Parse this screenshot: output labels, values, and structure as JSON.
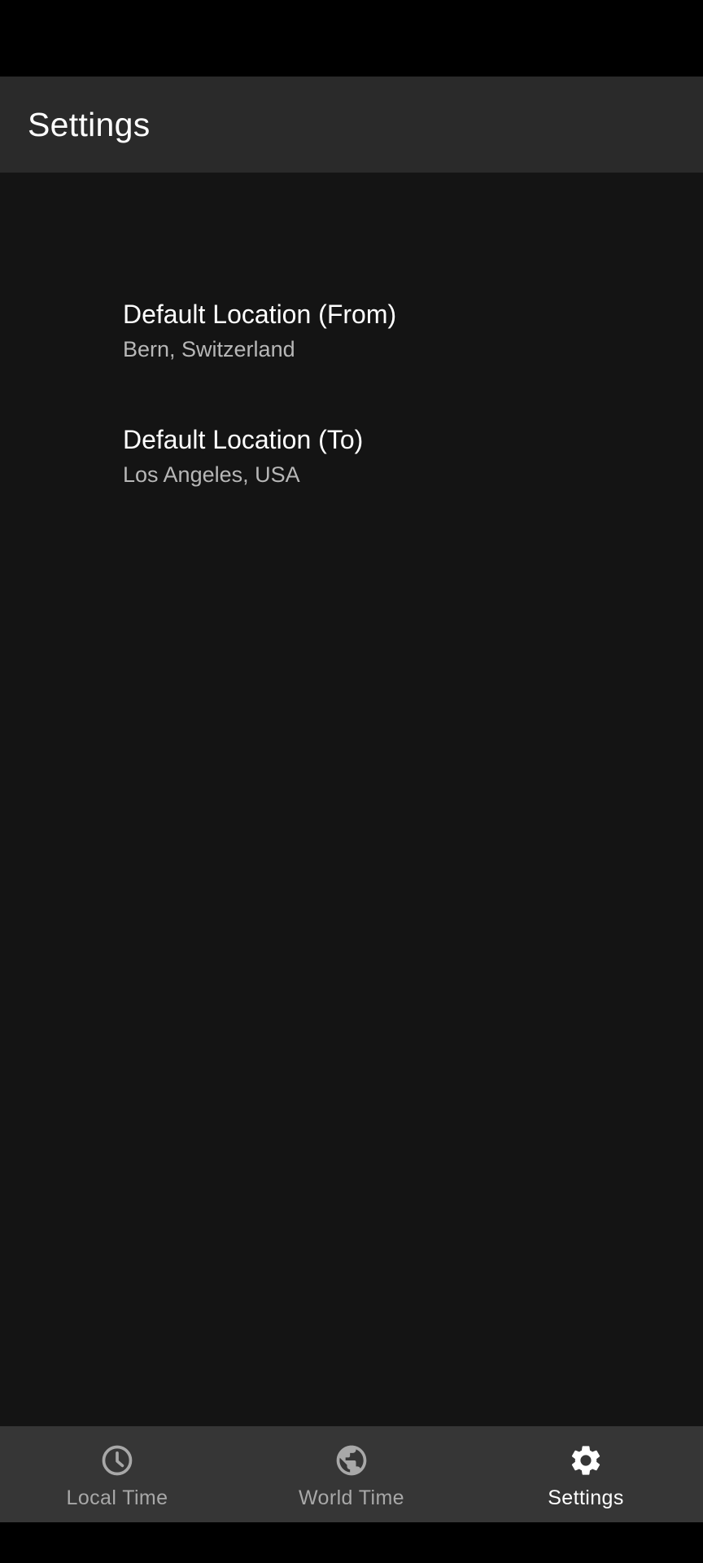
{
  "app_bar": {
    "title": "Settings"
  },
  "preferences": [
    {
      "title": "Default Location (From)",
      "summary": "Bern, Switzerland"
    },
    {
      "title": "Default Location (To)",
      "summary": "Los Angeles, USA"
    }
  ],
  "bottom_nav": {
    "items": [
      {
        "label": "Local Time",
        "icon": "clock-icon",
        "selected": false
      },
      {
        "label": "World Time",
        "icon": "globe-icon",
        "selected": false
      },
      {
        "label": "Settings",
        "icon": "gear-icon",
        "selected": true
      }
    ]
  },
  "colors": {
    "app_bar_bg": "#2a2a2a",
    "content_bg": "#141414",
    "nav_bg": "#363636",
    "active": "#ffffff",
    "inactive": "#a8a8a8"
  }
}
